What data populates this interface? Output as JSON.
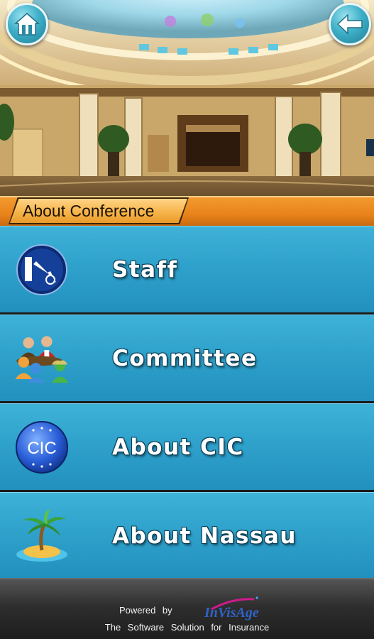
{
  "header": {
    "section_title": "About Conference",
    "home_icon": "home-icon",
    "back_icon": "back-arrow-icon"
  },
  "menu": {
    "items": [
      {
        "label": "Staff",
        "icon": "staff-icon"
      },
      {
        "label": "Committee",
        "icon": "committee-people-icon"
      },
      {
        "label": "About CIC",
        "icon": "cic-logo-icon",
        "icon_text": "CIC"
      },
      {
        "label": "About Nassau",
        "icon": "palm-island-icon"
      }
    ]
  },
  "footer": {
    "powered_by": "Powered by",
    "brand": "InVisAge",
    "tagline": "The Software Solution for Insurance"
  },
  "colors": {
    "menu_blue": "#2fa2cc",
    "banner_orange": "#e9831a",
    "footer_dark": "#2e2e2e",
    "brand_blue": "#2f63c6",
    "brand_magenta": "#d01a8c"
  }
}
